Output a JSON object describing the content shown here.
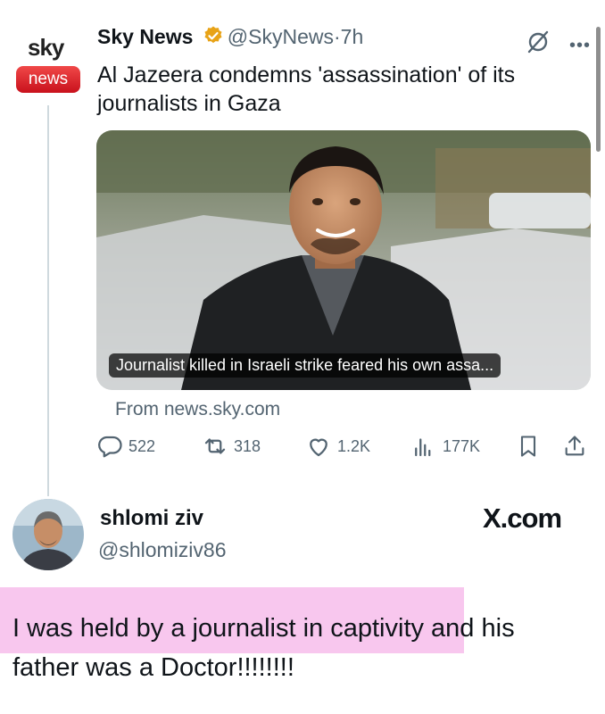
{
  "tweet": {
    "logo": {
      "word": "sky",
      "pill": "news"
    },
    "author_name": "Sky News",
    "handle": "@SkyNews",
    "separator": "·",
    "time": "7h",
    "text": "Al Jazeera condemns 'assassination' of its journalists in Gaza",
    "card": {
      "caption": "Journalist killed in Israeli strike feared his own assa...",
      "source": "From news.sky.com"
    },
    "actions": {
      "replies": "522",
      "reposts": "318",
      "likes": "1.2K",
      "views": "177K"
    }
  },
  "reply": {
    "name": "shlomi ziv",
    "handle": "@shlomiziv86",
    "brand": "X.com",
    "text": "I was held by a journalist in captivity and his father was a Doctor!!!!!!!!"
  },
  "colors": {
    "highlight": "#f8c7ee",
    "verified": "#e8a317",
    "sky_red": "#d91c24",
    "secondary_text": "#536471"
  }
}
